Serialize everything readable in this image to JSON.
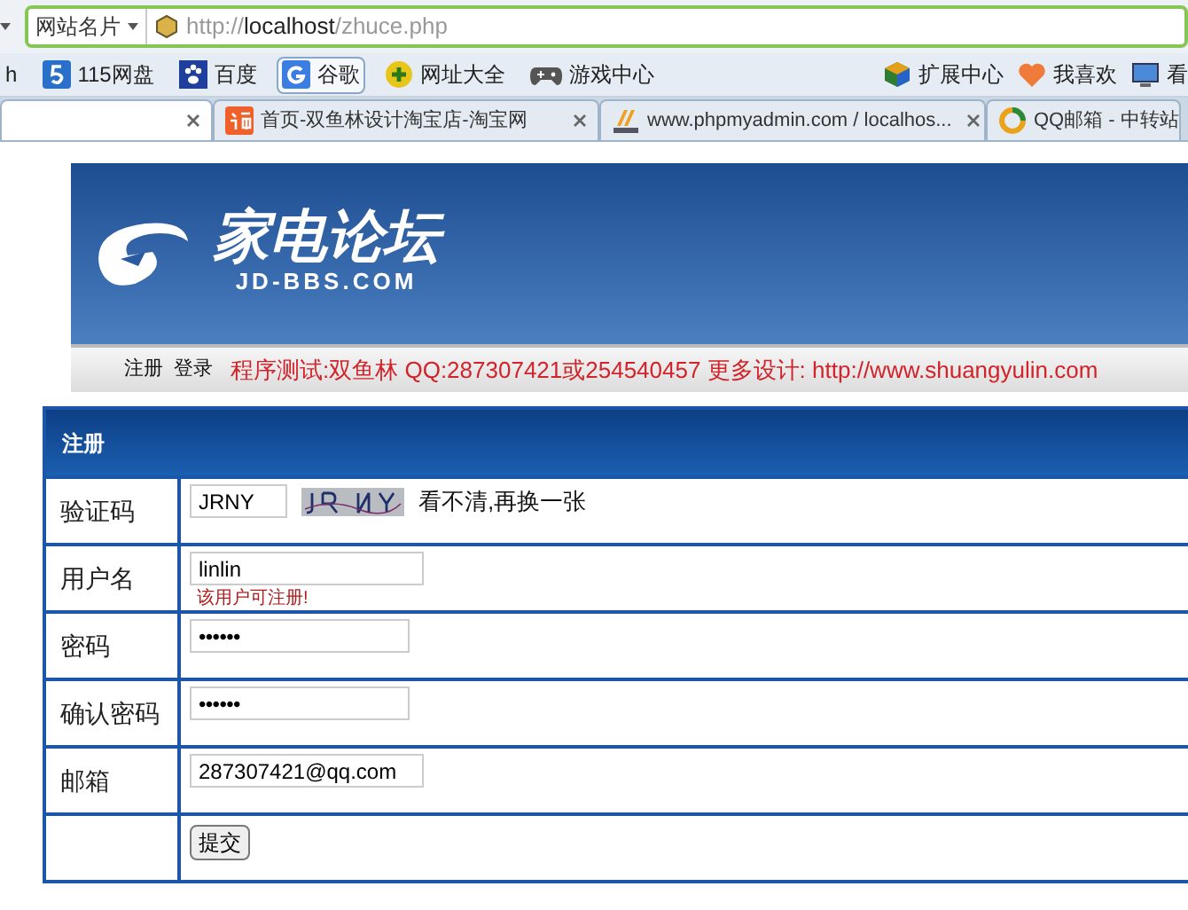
{
  "address_bar": {
    "site_menu": "网站名片",
    "url_prefix": "http://",
    "url_host": "localhost",
    "url_path": "/zhuce.php"
  },
  "bookmarks": [
    {
      "label": "h",
      "selected": false
    },
    {
      "label": "115网盘",
      "selected": false
    },
    {
      "label": "百度",
      "selected": false
    },
    {
      "label": "谷歌",
      "selected": true
    },
    {
      "label": "网址大全",
      "selected": false
    },
    {
      "label": "游戏中心",
      "selected": false
    }
  ],
  "bookmarks_right": [
    {
      "label": "扩展中心"
    },
    {
      "label": "我喜欢"
    },
    {
      "label": "看"
    }
  ],
  "tabs": [
    {
      "selected": true
    },
    {
      "title": "首页-双鱼林设计淘宝店-淘宝网",
      "selected": false
    },
    {
      "title": "www.phpmyadmin.com / localhos...",
      "selected": false
    },
    {
      "title": "QQ邮箱 - 中转站",
      "selected": false
    }
  ],
  "banner": {
    "logo_title": "家电论坛",
    "logo_subtitle": "JD-BBS.COM"
  },
  "nav": {
    "links": [
      "注册",
      "登录"
    ],
    "notice": "程序测试:双鱼林 QQ:287307421或254540457 更多设计: http://www.shuangyulin.com"
  },
  "form": {
    "title": "注册",
    "rows": [
      {
        "label": "验证码",
        "kind": "captcha",
        "value": "JRNY",
        "link": "看不清,再换一张"
      },
      {
        "label": "用户名",
        "kind": "text",
        "value": "linlin",
        "hint": "该用户可注册!"
      },
      {
        "label": "密码",
        "kind": "password",
        "value": "••••••"
      },
      {
        "label": "确认密码",
        "kind": "password",
        "value": "••••••"
      },
      {
        "label": "邮箱",
        "kind": "text",
        "value": "287307421@qq.com"
      },
      {
        "kind": "submit",
        "value": "提交"
      }
    ]
  }
}
